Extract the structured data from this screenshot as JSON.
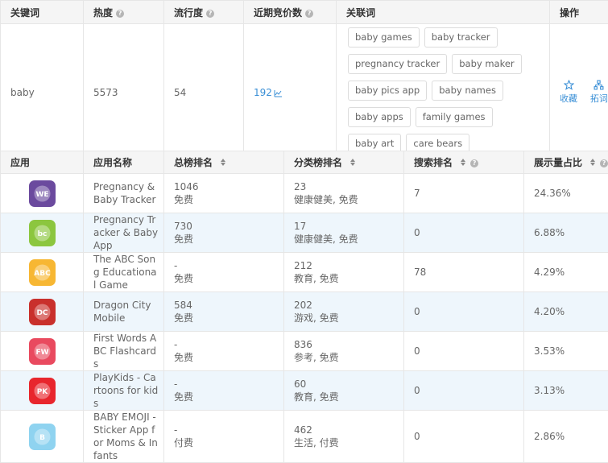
{
  "keyword_table": {
    "headers": {
      "keyword": "关键词",
      "heat": "热度",
      "popularity": "流行度",
      "recent_bids": "近期竞价数",
      "related": "关联词",
      "actions": "操作"
    },
    "row": {
      "keyword": "baby",
      "heat": "5573",
      "popularity": "54",
      "recent_bids": "192",
      "related_tags": [
        "baby games",
        "baby tracker",
        "pregnancy tracker",
        "baby maker",
        "baby pics app",
        "baby names",
        "baby apps",
        "family games",
        "baby art",
        "care bears"
      ],
      "actions": {
        "favorite": "收藏",
        "expand": "拓词"
      }
    }
  },
  "app_table": {
    "headers": {
      "app": "应用",
      "app_name": "应用名称",
      "total_rank": "总榜排名",
      "category_rank": "分类榜排名",
      "search_rank": "搜索排名",
      "impression_share": "展示量占比"
    },
    "rows": [
      {
        "name": "Pregnancy & Baby Tracker",
        "total_rank": "1046",
        "total_price": "免费",
        "cat_rank": "23",
        "cat_label": "健康健美, 免费",
        "search_rank": "7",
        "share": "24.36%",
        "icon": "what-to-expect-icon",
        "icon_color": "#6b4a9e"
      },
      {
        "name": "Pregnancy Tracker & Baby App",
        "total_rank": "730",
        "total_price": "免费",
        "cat_rank": "17",
        "cat_label": "健康健美, 免费",
        "search_rank": "0",
        "share": "6.88%",
        "icon": "babycenter-icon",
        "icon_color": "#8cc63f"
      },
      {
        "name": "The ABC Song Educational Game",
        "total_rank": "-",
        "total_price": "免费",
        "cat_rank": "212",
        "cat_label": "教育, 免费",
        "search_rank": "78",
        "share": "4.29%",
        "icon": "abc-song-icon",
        "icon_color": "#f7b733"
      },
      {
        "name": "Dragon City Mobile",
        "total_rank": "584",
        "total_price": "免费",
        "cat_rank": "202",
        "cat_label": "游戏, 免费",
        "search_rank": "0",
        "share": "4.20%",
        "icon": "dragon-city-icon",
        "icon_color": "#c9302c"
      },
      {
        "name": "First Words ABC Flashcards",
        "total_rank": "-",
        "total_price": "免费",
        "cat_rank": "836",
        "cat_label": "参考, 免费",
        "search_rank": "0",
        "share": "3.53%",
        "icon": "first-words-icon",
        "icon_color": "#e94a5f"
      },
      {
        "name": "PlayKids - Cartoons for kids",
        "total_rank": "-",
        "total_price": "免费",
        "cat_rank": "60",
        "cat_label": "教育, 免费",
        "search_rank": "0",
        "share": "3.13%",
        "icon": "playkids-icon",
        "icon_color": "#e8262d"
      },
      {
        "name": "BABY EMOJI - Sticker App for Moms & Infants",
        "total_rank": "-",
        "total_price": "付费",
        "cat_rank": "462",
        "cat_label": "生活, 付费",
        "search_rank": "0",
        "share": "2.86%",
        "icon": "baby-emoji-icon",
        "icon_color": "#8fd3f0"
      }
    ]
  }
}
